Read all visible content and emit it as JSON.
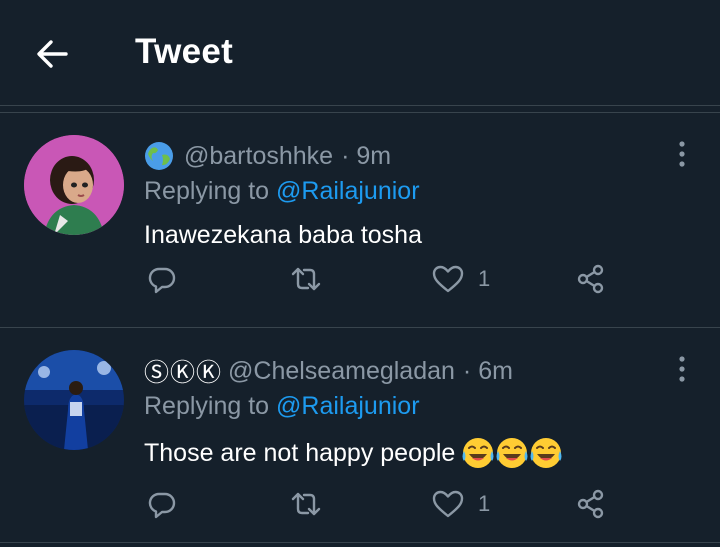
{
  "header": {
    "title": "Tweet",
    "back_icon": "arrow-left-icon"
  },
  "tweets": [
    {
      "display_name": "",
      "handle": "@bartoshhke",
      "time": "· 9m",
      "reply_prefix": "Replying to",
      "reply_to": "@Railajunior",
      "text": "Inawezekana baba tosha",
      "emoji_count": 0,
      "likes": "1",
      "icons": [
        "globe-emoji-icon",
        "reply-icon",
        "retweet-icon",
        "like-icon",
        "share-icon",
        "more-icon"
      ]
    },
    {
      "display_name": "ⓈⓀⓀ",
      "handle": "@Chelseamegladan",
      "time": "· 6m",
      "reply_prefix": "Replying to",
      "reply_to": "@Railajunior",
      "text": "Those are not happy people",
      "emoji_count": 3,
      "likes": "1",
      "icons": [
        "tears-of-joy-emoji-icon",
        "reply-icon",
        "retweet-icon",
        "like-icon",
        "share-icon",
        "more-icon"
      ]
    }
  ],
  "colors": {
    "background": "#15202b",
    "divider": "#38444d",
    "secondary_text": "#8b98a5",
    "link": "#1d9bf0",
    "text": "#ffffff"
  }
}
